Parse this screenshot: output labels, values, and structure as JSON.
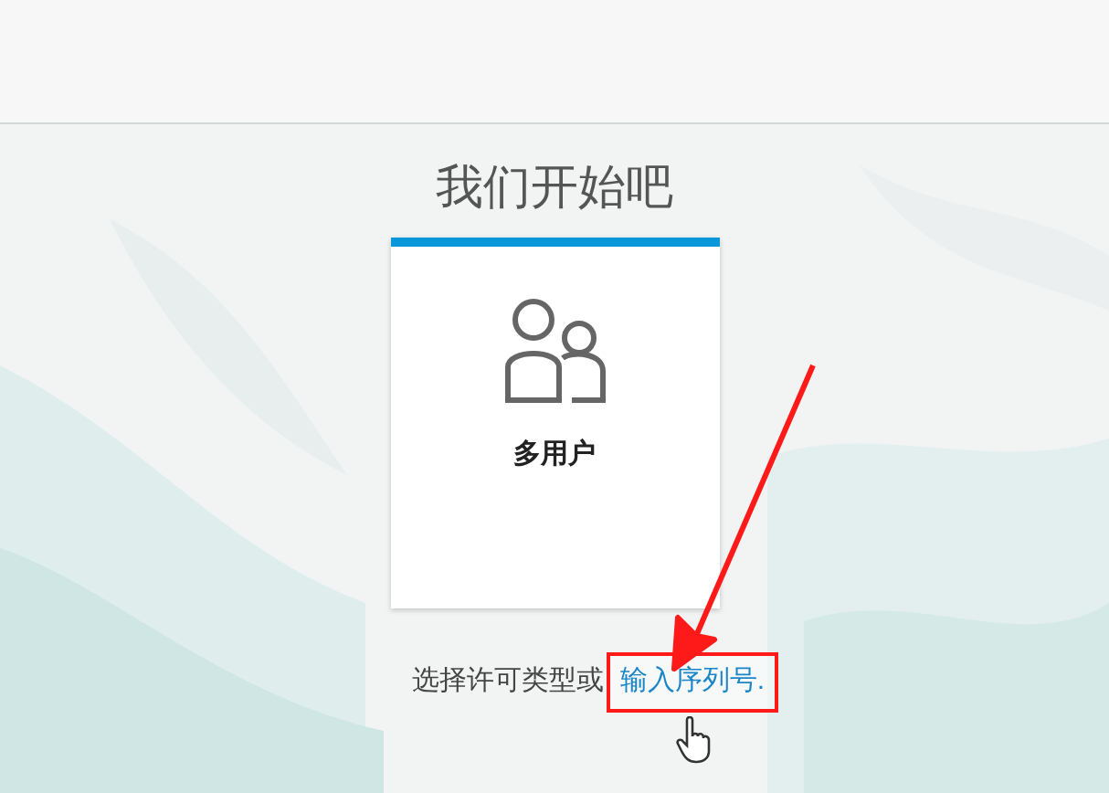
{
  "title": "我们开始吧",
  "license_cards": [
    {
      "label": "多用户"
    }
  ],
  "prompt": {
    "text": "选择许可类型或",
    "link": "输入序列号",
    "suffix": "."
  }
}
